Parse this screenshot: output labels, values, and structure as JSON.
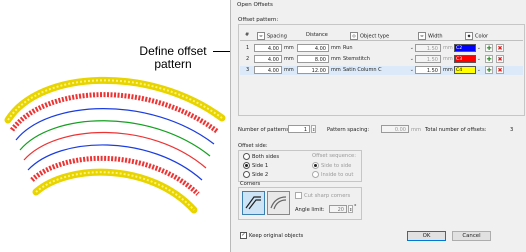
{
  "callout": {
    "text": "Define offset pattern"
  },
  "dialog": {
    "title": "Open Offsets",
    "offset_pattern_group": "Offset pattern:",
    "columns": {
      "num": "#",
      "spacing": "Spacing",
      "distance": "Distance",
      "object_type": "Object type",
      "width": "Width",
      "color": "Color"
    },
    "rows": [
      {
        "num": "1",
        "spacing": "4.00",
        "spacing_unit": "mm",
        "distance": "4.00",
        "distance_unit": "mm",
        "object_type": "Run",
        "width": "1.50",
        "width_unit": "mm",
        "color_code": "C2",
        "color": "#0000ff"
      },
      {
        "num": "2",
        "spacing": "4.00",
        "spacing_unit": "mm",
        "distance": "8.00",
        "distance_unit": "mm",
        "object_type": "Stemstitch",
        "width": "1.50",
        "width_unit": "mm",
        "color_code": "C3",
        "color": "#ff0000"
      },
      {
        "num": "3",
        "spacing": "4.00",
        "spacing_unit": "mm",
        "distance": "12.00",
        "distance_unit": "mm",
        "object_type": "Satin Column C",
        "width": "1.50",
        "width_unit": "mm",
        "color_code": "C4",
        "color": "#ffff00"
      }
    ],
    "num_patterns_label": "Number of patterns:",
    "num_patterns_value": "1",
    "pattern_spacing_label": "Pattern spacing:",
    "pattern_spacing_value": "0.00",
    "pattern_spacing_unit": "mm",
    "total_label": "Total number of offsets:",
    "total_value": "3",
    "offset_side_group": "Offset side:",
    "sides": {
      "both": "Both sides",
      "side1": "Side 1",
      "side2": "Side 2"
    },
    "sequence_label": "Offset sequence:",
    "sequence": {
      "side_to_side": "Side to side",
      "inside_to_out": "Inside to out"
    },
    "corners_label": "Corners",
    "cut_sharp_corners": "Cut sharp corners",
    "angle_limit_label": "Angle limit:",
    "angle_limit_value": "20",
    "angle_unit": "°",
    "keep_original": "Keep original objects",
    "ok": "OK",
    "cancel": "Cancel"
  }
}
